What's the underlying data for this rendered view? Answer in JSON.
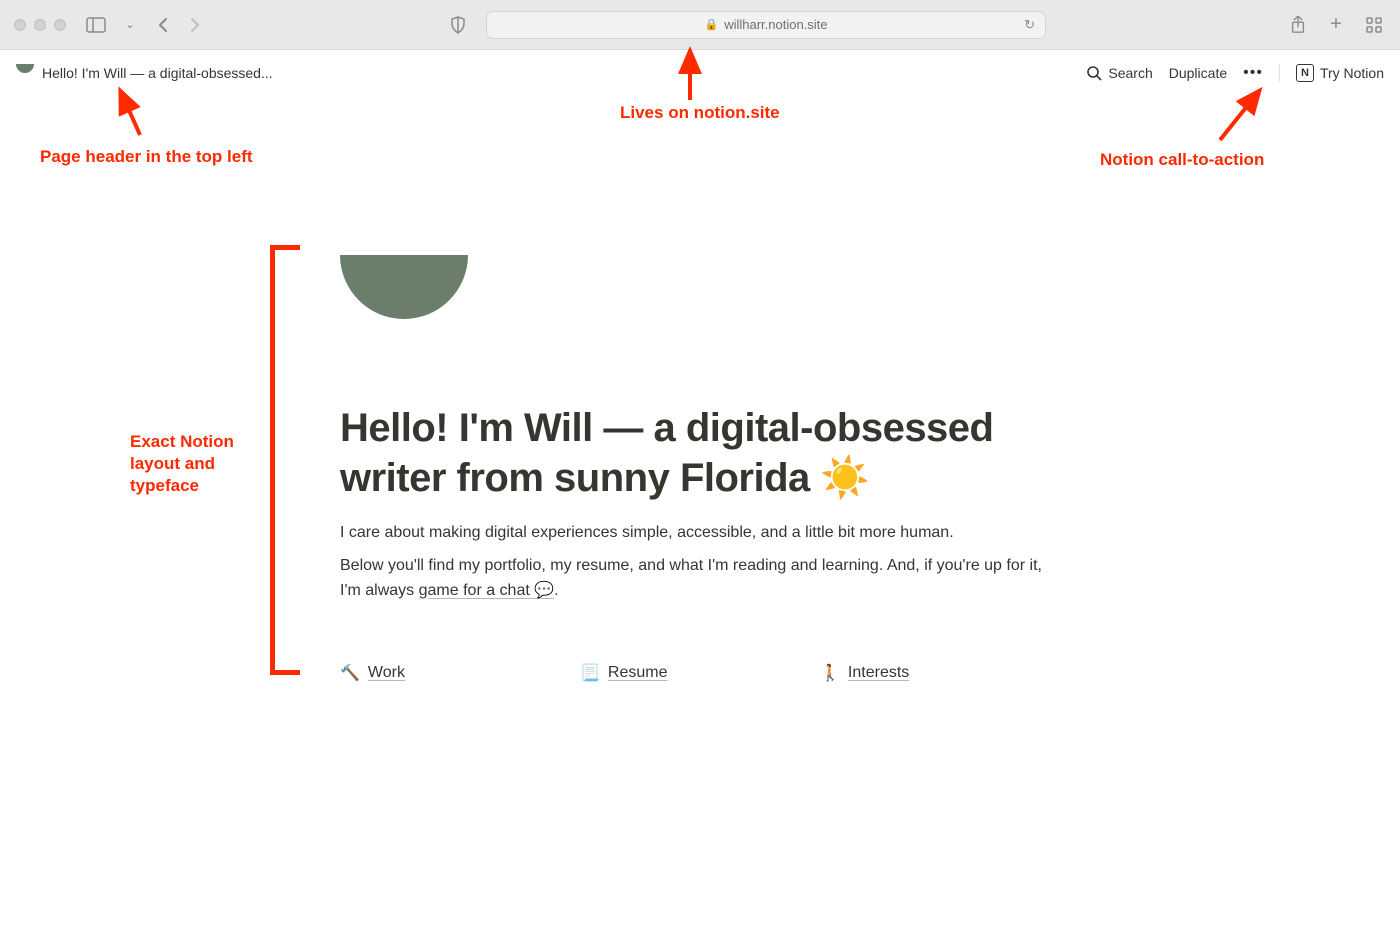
{
  "browser": {
    "url_display": "willharr.notion.site"
  },
  "notion_bar": {
    "breadcrumb_title": "Hello! I'm Will — a digital-obsessed...",
    "search_label": "Search",
    "duplicate_label": "Duplicate",
    "try_label": "Try Notion"
  },
  "page": {
    "title": "Hello! I'm Will — a digital-obsessed writer from sunny Florida ☀️",
    "para1": "I care about making digital experiences simple, accessible, and a little bit more human.",
    "para2_a": "Below you'll find my portfolio, my resume, and what I'm reading and learning. And, if you're up for it, I'm always ",
    "para2_link": "game for a chat 💬",
    "para2_b": ".",
    "links": [
      {
        "emoji": "🔨",
        "label": "Work"
      },
      {
        "emoji": "📃",
        "label": "Resume"
      },
      {
        "emoji": "🚶",
        "label": "Interests"
      }
    ]
  },
  "annotations": {
    "top_center": "Lives on notion.site",
    "top_left": "Page header in the top left",
    "top_right": "Notion call-to-action",
    "side": "Exact Notion layout and typeface"
  }
}
